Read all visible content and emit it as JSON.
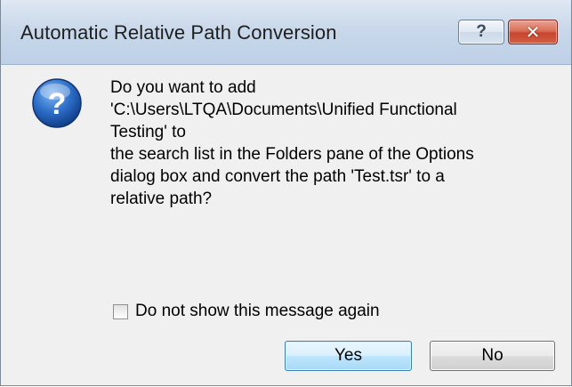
{
  "dialog": {
    "title": "Automatic Relative Path Conversion",
    "help_glyph": "?",
    "close_glyph": "✕",
    "icon": "question-icon",
    "icon_glyph": "?",
    "message_lines": [
      "Do you want to add",
      "'C:\\Users\\LTQA\\Documents\\Unified Functional",
      "Testing' to",
      "the search list in the Folders pane of the Options",
      "dialog box and convert the path 'Test.tsr' to a",
      "relative path?"
    ],
    "checkbox": {
      "label": "Do not show this message again",
      "checked": false
    },
    "buttons": {
      "yes": "Yes",
      "no": "No"
    }
  },
  "colors": {
    "titlebar": "#c9d8ea",
    "close_button": "#c7452d",
    "default_button": "#bee6fd",
    "icon_blue": "#1f5fb8"
  }
}
